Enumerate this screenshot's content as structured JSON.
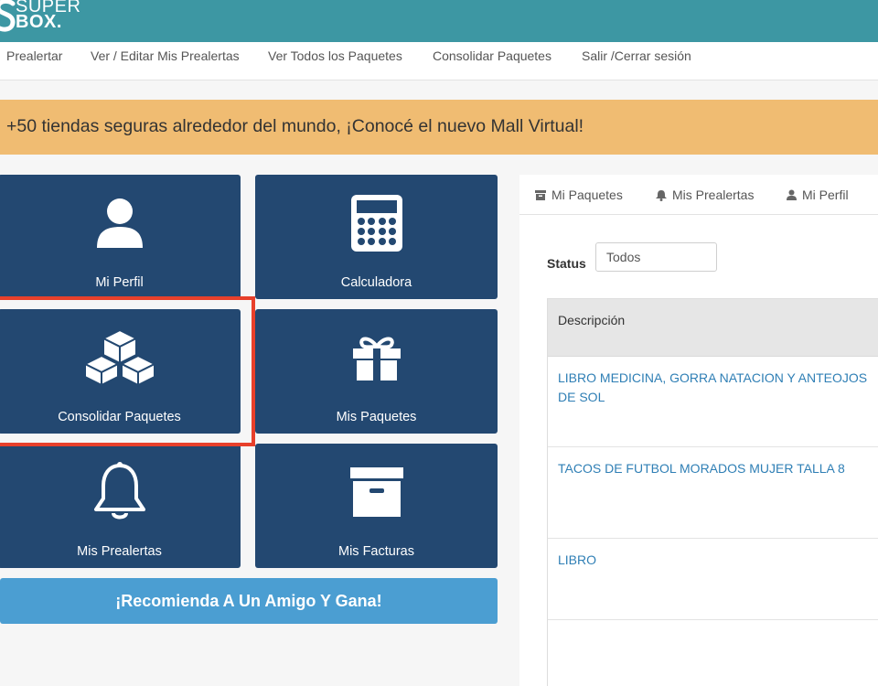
{
  "brand": {
    "line1": "SUPER",
    "line2": "BOX."
  },
  "nav": {
    "items": [
      {
        "label": "Prealertar"
      },
      {
        "label": "Ver / Editar Mis Prealertas"
      },
      {
        "label": "Ver Todos los Paquetes"
      },
      {
        "label": "Consolidar Paquetes"
      },
      {
        "label": "Salir /Cerrar sesión"
      }
    ]
  },
  "banner": {
    "text": "+50 tiendas seguras alrededor del mundo, ¡Conocé el nuevo Mall Virtual!"
  },
  "tiles": [
    {
      "label": "Mi Perfil",
      "icon": "user-icon"
    },
    {
      "label": "Calculadora",
      "icon": "calculator-icon"
    },
    {
      "label": "Consolidar Paquetes",
      "icon": "cubes-icon"
    },
    {
      "label": "Mis Paquetes",
      "icon": "gift-icon"
    },
    {
      "label": "Mis Prealertas",
      "icon": "bell-icon"
    },
    {
      "label": "Mis Facturas",
      "icon": "archive-icon"
    }
  ],
  "refer": {
    "label": "¡Recomienda A Un Amigo Y Gana!"
  },
  "panel": {
    "tabs": [
      {
        "label": "Mi Paquetes",
        "icon": "archive-icon"
      },
      {
        "label": "Mis Prealertas",
        "icon": "bell-icon"
      },
      {
        "label": "Mi Perfil",
        "icon": "user-icon"
      }
    ],
    "status_label": "Status",
    "status_value": "Todos",
    "table": {
      "header": "Descripción",
      "rows": [
        {
          "description": "LIBRO MEDICINA, GORRA NATACION Y ANTEOJOS DE SOL"
        },
        {
          "description": "TACOS DE FUTBOL MORADOS MUJER TALLA 8"
        },
        {
          "description": "LIBRO"
        },
        {
          "description": ""
        }
      ]
    }
  },
  "colors": {
    "topbar": "#3d97a3",
    "tile": "#234871",
    "banner": "#f0bc72",
    "refer": "#4b9ed2",
    "highlight": "#e8402b",
    "link": "#2f7fb5"
  }
}
